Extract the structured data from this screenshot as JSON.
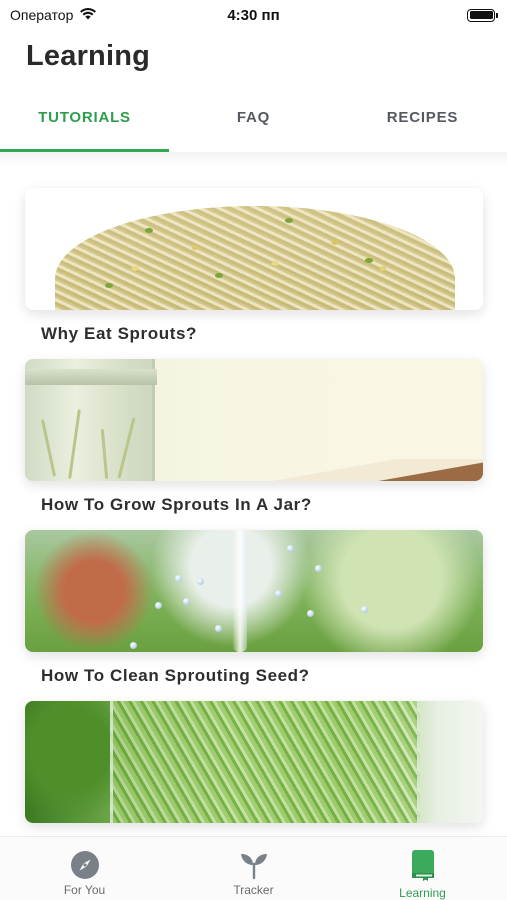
{
  "status_bar": {
    "carrier": "Оператор",
    "time": "4:30 пп"
  },
  "header": {
    "title": "Learning"
  },
  "tabs": [
    {
      "label": "TUTORIALS",
      "active": true
    },
    {
      "label": "FAQ",
      "active": false
    },
    {
      "label": "RECIPES",
      "active": false
    }
  ],
  "tutorials": [
    {
      "title": "Why Eat Sprouts?"
    },
    {
      "title": "How To Grow Sprouts In A Jar?"
    },
    {
      "title": "How To Clean Sprouting Seed?"
    },
    {
      "title": ""
    }
  ],
  "tabbar": {
    "items": [
      {
        "label": "For You",
        "icon": "compass-icon",
        "active": false
      },
      {
        "label": "Tracker",
        "icon": "sprout-icon",
        "active": false
      },
      {
        "label": "Learning",
        "icon": "book-icon",
        "active": true
      }
    ]
  },
  "colors": {
    "accent": "#34a853",
    "accent_text": "#2e9e4f",
    "tab_inactive": "#555a60"
  }
}
